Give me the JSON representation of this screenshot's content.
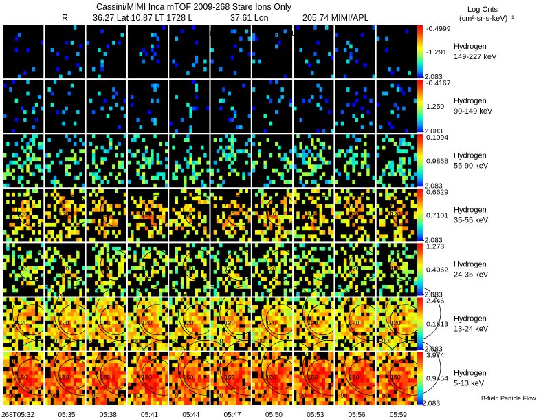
{
  "header": {
    "title": "Cassini/MIMI Inca mTOF  2009-268   Stare   Ions Only",
    "r_label": "R",
    "lat_lt_l": "36.27 Lat 10.87 LT 1728 L",
    "lon": "37.61 Lon",
    "lon_value_org": "205.74  MIMI/APL",
    "units_line1": "Log Cnts",
    "units_line2": "(cm²-sr-s-keV)⁻¹",
    "overlay_labels": [
      "satur",
      "saturn",
      "skr-wt"
    ]
  },
  "footer": {
    "bfield_note": "B-field Particle Flow"
  },
  "chart_data": {
    "type": "heatmap",
    "title": "Cassini/MIMI Inca mTOF  2009-268   Stare   Ions Only",
    "time_labels": [
      "268T05:32",
      "05:35",
      "05:38",
      "05:41",
      "05:44",
      "05:47",
      "05:50",
      "05:53",
      "05:56",
      "05:59"
    ],
    "colorscale": [
      "#0000ff",
      "#00a0ff",
      "#00ffc8",
      "#a0ff40",
      "#ffff00",
      "#ffa000",
      "#ff3c00",
      "#ff0000"
    ],
    "colorbar_unit": "Log Cnts (cm²-sr-s-keV)⁻¹",
    "contour_labels": [
      "90",
      "120",
      "150"
    ],
    "rows": [
      {
        "species": "Hydrogen",
        "energy": "149-227 keV",
        "cmax": "-0.4999",
        "cmid": "-1.291",
        "cmin": "-2.083",
        "intensity": 0.08,
        "density": 0.08
      },
      {
        "species": "Hydrogen",
        "energy": "90-149 keV",
        "cmax": "-0.4167",
        "cmid": "1.250",
        "cmin": "-2.083",
        "intensity": 0.12,
        "density": 0.12
      },
      {
        "species": "Hydrogen",
        "energy": "55-90 keV",
        "cmax": "0.1094",
        "cmid": "0.9868",
        "cmin": "-2.083",
        "intensity": 0.32,
        "density": 0.35
      },
      {
        "species": "Hydrogen",
        "energy": "35-55 keV",
        "cmax": "0.6629",
        "cmid": "0.7101",
        "cmin": "-2.083",
        "intensity": 0.6,
        "density": 0.5
      },
      {
        "species": "Hydrogen",
        "energy": "24-35 keV",
        "cmax": "1.273",
        "cmid": "0.4062",
        "cmin": "-2.083",
        "intensity": 0.48,
        "density": 0.5
      },
      {
        "species": "Hydrogen",
        "energy": "13-24 keV",
        "cmax": "2.446",
        "cmid": "0.1813",
        "cmin": "-2.083",
        "intensity": 0.62,
        "density": 0.72
      },
      {
        "species": "Hydrogen",
        "energy": "5-13 keV",
        "cmax": "3.974",
        "cmid": "0.9454",
        "cmin": "2.083",
        "intensity": 0.8,
        "density": 0.85
      }
    ]
  }
}
